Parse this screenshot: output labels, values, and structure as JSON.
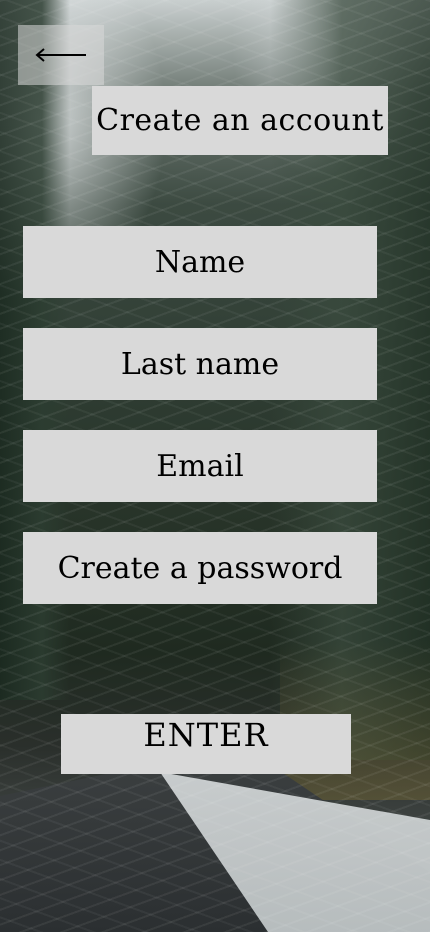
{
  "navigation": {
    "back_icon": "arrow-left-icon"
  },
  "header": {
    "title": "Create an account"
  },
  "form": {
    "name_placeholder": "Name",
    "lastname_placeholder": "Last name",
    "email_placeholder": "Email",
    "password_placeholder": "Create a password",
    "submit_label": "ENTER"
  },
  "colors": {
    "box_background": "#d9d9d9",
    "text": "#000000"
  }
}
